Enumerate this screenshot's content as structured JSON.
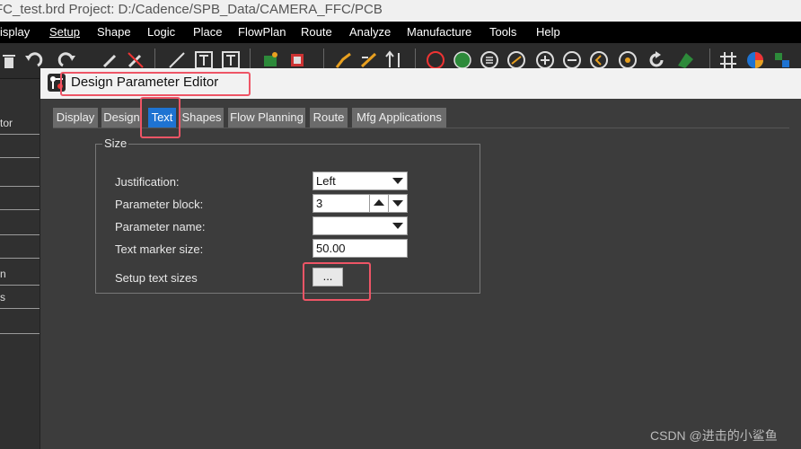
{
  "window": {
    "title": "FC_test.brd  Project: D:/Cadence/SPB_Data/CAMERA_FFC/PCB"
  },
  "menu": {
    "items": [
      "isplay",
      "Setup",
      "Shape",
      "Logic",
      "Place",
      "FlowPlan",
      "Route",
      "Analyze",
      "Manufacture",
      "Tools",
      "Help"
    ]
  },
  "left_panel": {
    "labels": [
      "tor",
      "",
      "",
      "",
      "",
      "",
      "n",
      "s",
      ""
    ]
  },
  "dialog": {
    "title": "Design Parameter Editor",
    "tabs": [
      "Display",
      "Design",
      "Text",
      "Shapes",
      "Flow Planning",
      "Route",
      "Mfg Applications"
    ],
    "active_tab": "Text",
    "group_title": "Size",
    "fields": {
      "justification": {
        "label": "Justification:",
        "value": "Left"
      },
      "parameter_block": {
        "label": "Parameter block:",
        "value": "3"
      },
      "parameter_name": {
        "label": "Parameter name:",
        "value": ""
      },
      "text_marker_size": {
        "label": "Text marker size:",
        "value": "50.00"
      },
      "setup_text_sizes": {
        "label": "Setup text sizes",
        "button": "..."
      }
    }
  },
  "watermark": "CSDN @进击的小鲨鱼",
  "colors": {
    "active_tab": "#1e73d2",
    "highlight": "#ee5566",
    "dialog_bg": "#3c3c3c"
  }
}
